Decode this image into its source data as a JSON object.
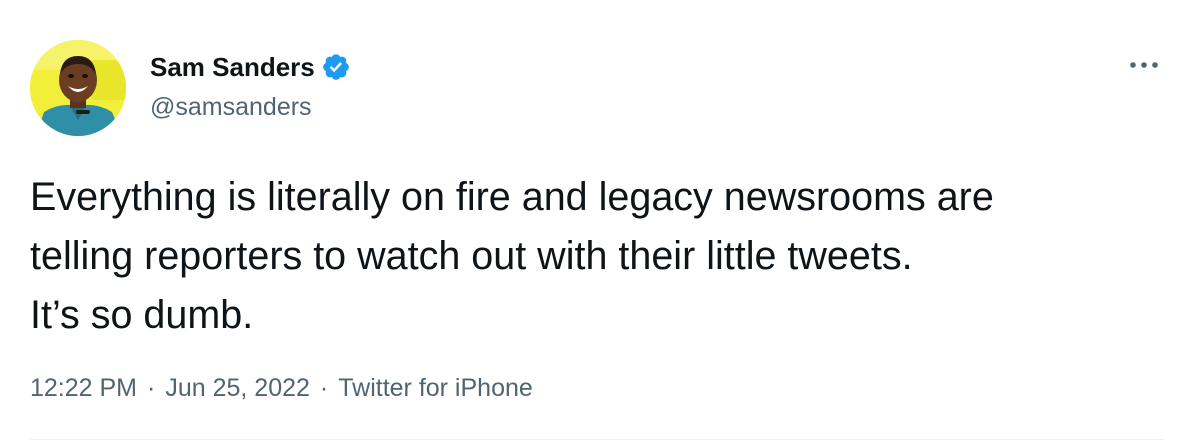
{
  "tweet": {
    "author": {
      "display_name": "Sam Sanders",
      "handle": "@samsanders",
      "verified": true,
      "avatar_icon": "profile-photo"
    },
    "text": "Everything is literally on fire and legacy newsrooms are\ntelling reporters to watch out with their little tweets.\nIt’s so dumb.",
    "time": "12:22 PM",
    "date": "Jun 25, 2022",
    "source": "Twitter for iPhone",
    "separator": "·",
    "more_icon": "more-horizontal-icon"
  },
  "colors": {
    "text_primary": "#0f1419",
    "text_secondary": "#536471",
    "verified_blue": "#1d9bf0",
    "avatar_background": "#f2ee3a",
    "divider": "#eff3f4"
  }
}
